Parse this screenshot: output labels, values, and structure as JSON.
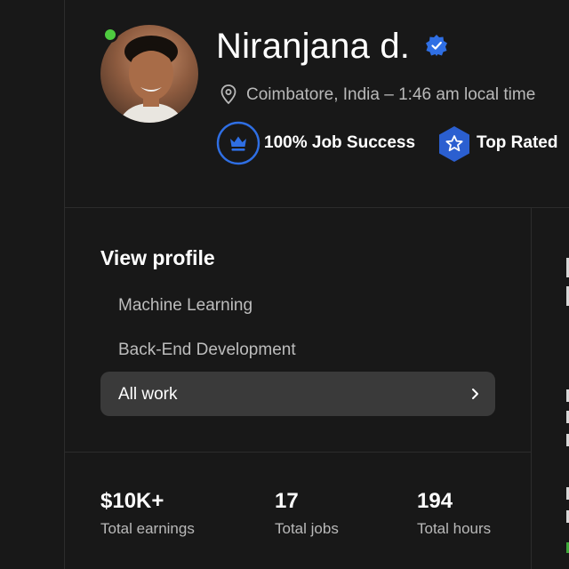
{
  "profile": {
    "name": "Niranjana d.",
    "location": "Coimbatore, India – 1:46 am local time",
    "job_success": "100% Job Success",
    "top_rated": "Top Rated",
    "online": true
  },
  "nav": {
    "title": "View profile",
    "items": [
      {
        "label": "Machine Learning"
      },
      {
        "label": "Back-End Development"
      },
      {
        "label": "All work",
        "selected": true
      }
    ]
  },
  "stats": [
    {
      "value": "$10K+",
      "label": "Total earnings"
    },
    {
      "value": "17",
      "label": "Total jobs"
    },
    {
      "value": "194",
      "label": "Total hours"
    }
  ],
  "colors": {
    "background": "#181818",
    "accent_blue": "#2f6fe4",
    "online_green": "#4ecb3f",
    "selected_bg": "#3a3a3a"
  },
  "icons": [
    "verified-check-icon",
    "location-pin-icon",
    "crown-badge-icon",
    "star-badge-icon",
    "chevron-right-icon"
  ]
}
